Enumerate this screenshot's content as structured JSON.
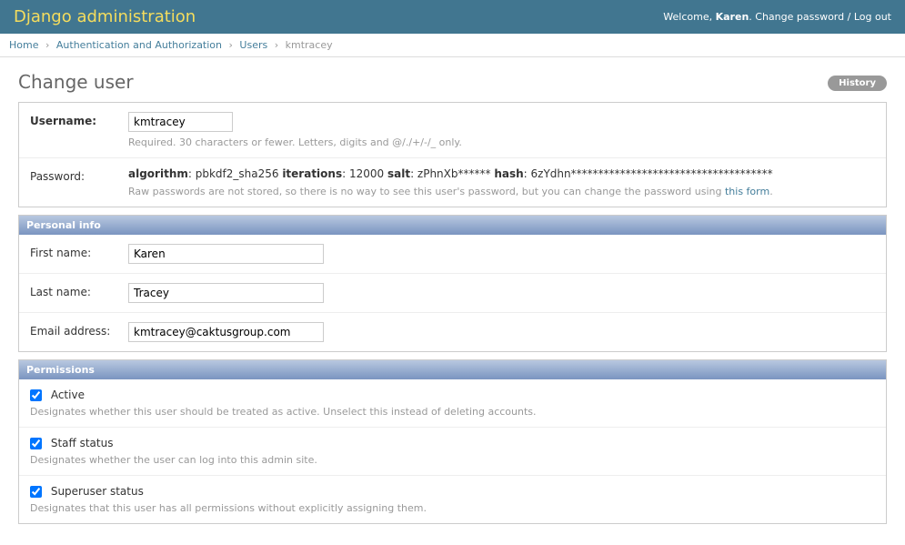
{
  "header": {
    "site_title": "Django administration",
    "welcome_prefix": "Welcome, ",
    "username": "Karen",
    "welcome_suffix": ". ",
    "change_password": "Change password",
    "separator": " / ",
    "logout": "Log out"
  },
  "breadcrumbs": {
    "home": "Home",
    "app": "Authentication and Authorization",
    "model": "Users",
    "object": "kmtracey"
  },
  "page_title": "Change user",
  "history_label": "History",
  "fields": {
    "username_label": "Username:",
    "username_value": "kmtracey",
    "username_help": "Required. 30 characters or fewer. Letters, digits and @/./+/-/_ only.",
    "password_label": "Password:",
    "pw_algorithm_label": "algorithm",
    "pw_algorithm_value": ": pbkdf2_sha256 ",
    "pw_iterations_label": "iterations",
    "pw_iterations_value": ": 12000 ",
    "pw_salt_label": "salt",
    "pw_salt_value": ": zPhnXb****** ",
    "pw_hash_label": "hash",
    "pw_hash_value": ": 6zYdhn*************************************",
    "password_help_prefix": "Raw passwords are not stored, so there is no way to see this user's password, but you can change the password using ",
    "password_help_link": "this form",
    "password_help_suffix": "."
  },
  "personal_info": {
    "heading": "Personal info",
    "first_name_label": "First name:",
    "first_name_value": "Karen",
    "last_name_label": "Last name:",
    "last_name_value": "Tracey",
    "email_label": "Email address:",
    "email_value": "kmtracey@caktusgroup.com"
  },
  "permissions": {
    "heading": "Permissions",
    "active_label": "Active",
    "active_help": "Designates whether this user should be treated as active. Unselect this instead of deleting accounts.",
    "staff_label": "Staff status",
    "staff_help": "Designates whether the user can log into this admin site.",
    "superuser_label": "Superuser status",
    "superuser_help": "Designates that this user has all permissions without explicitly assigning them."
  }
}
